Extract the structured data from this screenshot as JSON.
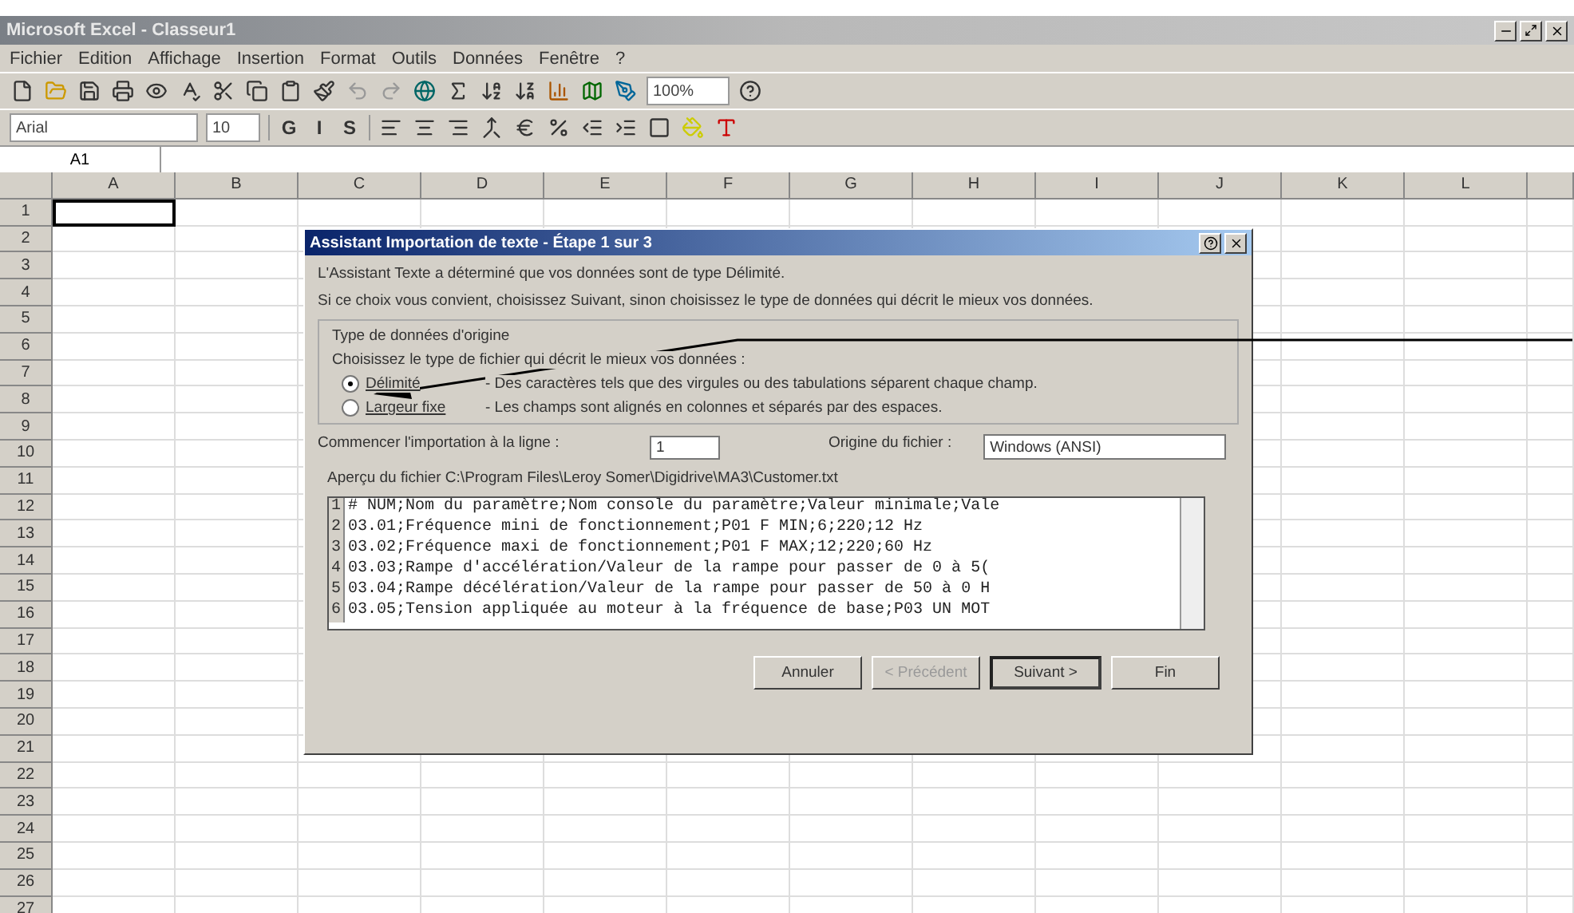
{
  "window": {
    "title": "Microsoft Excel - Classeur1"
  },
  "menu": [
    "Fichier",
    "Edition",
    "Affichage",
    "Insertion",
    "Format",
    "Outils",
    "Données",
    "Fenêtre",
    "?"
  ],
  "toolbar": {
    "zoom": "100%",
    "font": "Arial",
    "size": "10",
    "format_buttons": [
      "G",
      "I",
      "S"
    ]
  },
  "formula_bar": {
    "name_box": "A1"
  },
  "sheet": {
    "columns": [
      "A",
      "B",
      "C",
      "D",
      "E",
      "F",
      "G",
      "H",
      "I",
      "J",
      "K",
      "L"
    ],
    "rows": [
      "1",
      "2",
      "3",
      "4",
      "5",
      "6",
      "7",
      "8",
      "9",
      "10",
      "11",
      "12",
      "13",
      "14",
      "15",
      "16",
      "17",
      "18",
      "19",
      "20",
      "21",
      "22",
      "23",
      "24",
      "25",
      "26",
      "27"
    ]
  },
  "dialog": {
    "title": "Assistant Importation de texte - Étape 1 sur 3",
    "intro": [
      "L'Assistant Texte a déterminé que vos données sont de type Délimité.",
      "Si ce choix vous convient, choisissez Suivant, sinon choisissez le type de données qui décrit le mieux vos données."
    ],
    "group_title": "Type de données d'origine",
    "group_prompt": "Choisissez le type de fichier qui décrit le mieux vos données :",
    "options": [
      {
        "label": "Délimité",
        "description": "- Des caractères tels que des virgules ou des tabulations séparent chaque champ.",
        "selected": true
      },
      {
        "label": "Largeur fixe",
        "description": "- Les champs sont alignés en colonnes et séparés par des espaces.",
        "selected": false
      }
    ],
    "start_row_label": "Commencer l'importation à la ligne :",
    "start_row": "1",
    "origin_label": "Origine du fichier :",
    "origin": "Windows (ANSI)",
    "preview_label": "Aperçu du fichier C:\\Program Files\\Leroy Somer\\Digidrive\\MA3\\Customer.txt",
    "preview_lines": [
      {
        "number": "1",
        "text": "# NUM;Nom du paramètre;Nom console du paramètre;Valeur minimale;Vale"
      },
      {
        "number": "2",
        "text": "03.01;Fréquence mini de fonctionnement;P01 F MIN;6;220;12 Hz"
      },
      {
        "number": "3",
        "text": "03.02;Fréquence maxi de fonctionnement;P01 F MAX;12;220;60 Hz"
      },
      {
        "number": "4",
        "text": "03.03;Rampe d'accélération/Valeur de la rampe pour passer de 0 à 5("
      },
      {
        "number": "5",
        "text": "03.04;Rampe décélération/Valeur de la rampe pour passer de 50 à 0 H"
      },
      {
        "number": "6",
        "text": "03.05;Tension appliquée au moteur à la fréquence de base;P03 UN MOT"
      }
    ],
    "buttons": [
      {
        "label": "Annuler",
        "disabled": false,
        "default": false
      },
      {
        "label": "< Précédent",
        "disabled": true,
        "default": false
      },
      {
        "label": "Suivant >",
        "disabled": false,
        "default": true
      },
      {
        "label": "Fin",
        "disabled": false,
        "default": false
      }
    ]
  }
}
